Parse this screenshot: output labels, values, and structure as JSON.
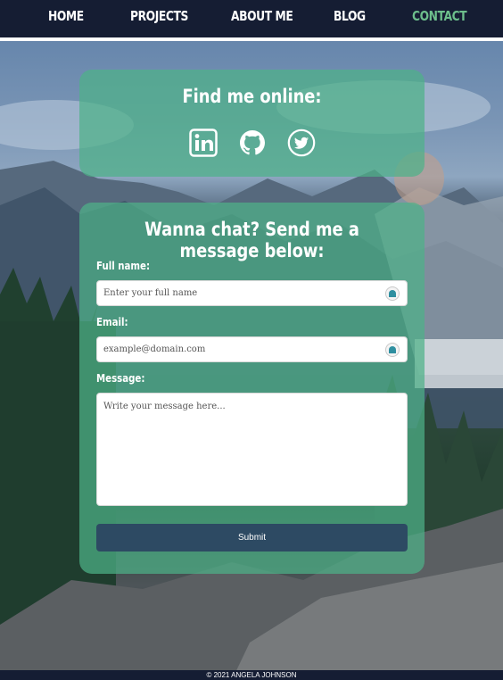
{
  "nav": {
    "items": [
      {
        "label": "HOME",
        "active": false
      },
      {
        "label": "PROJECTS",
        "active": false
      },
      {
        "label": "ABOUT ME",
        "active": false
      },
      {
        "label": "BLOG",
        "active": false
      },
      {
        "label": "CONTACT",
        "active": true
      }
    ],
    "active_color": "#6dbf8c"
  },
  "online": {
    "title": "Find me online:",
    "socials": [
      {
        "icon": "linkedin-icon"
      },
      {
        "icon": "github-icon"
      },
      {
        "icon": "twitter-icon"
      }
    ]
  },
  "form": {
    "title": "Wanna chat? Send me a message below:",
    "name_label": "Full name:",
    "name_placeholder": "Enter your full name",
    "email_label": "Email:",
    "email_placeholder": "example@domain.com",
    "message_label": "Message:",
    "message_placeholder": "Write your message here...",
    "submit_label": "Submit"
  },
  "footer": {
    "text": "© 2021 ANGELA JOHNSON"
  },
  "colors": {
    "card": "#4eb288",
    "nav_bg": "#151d33",
    "submit_bg": "#2d4a63"
  }
}
